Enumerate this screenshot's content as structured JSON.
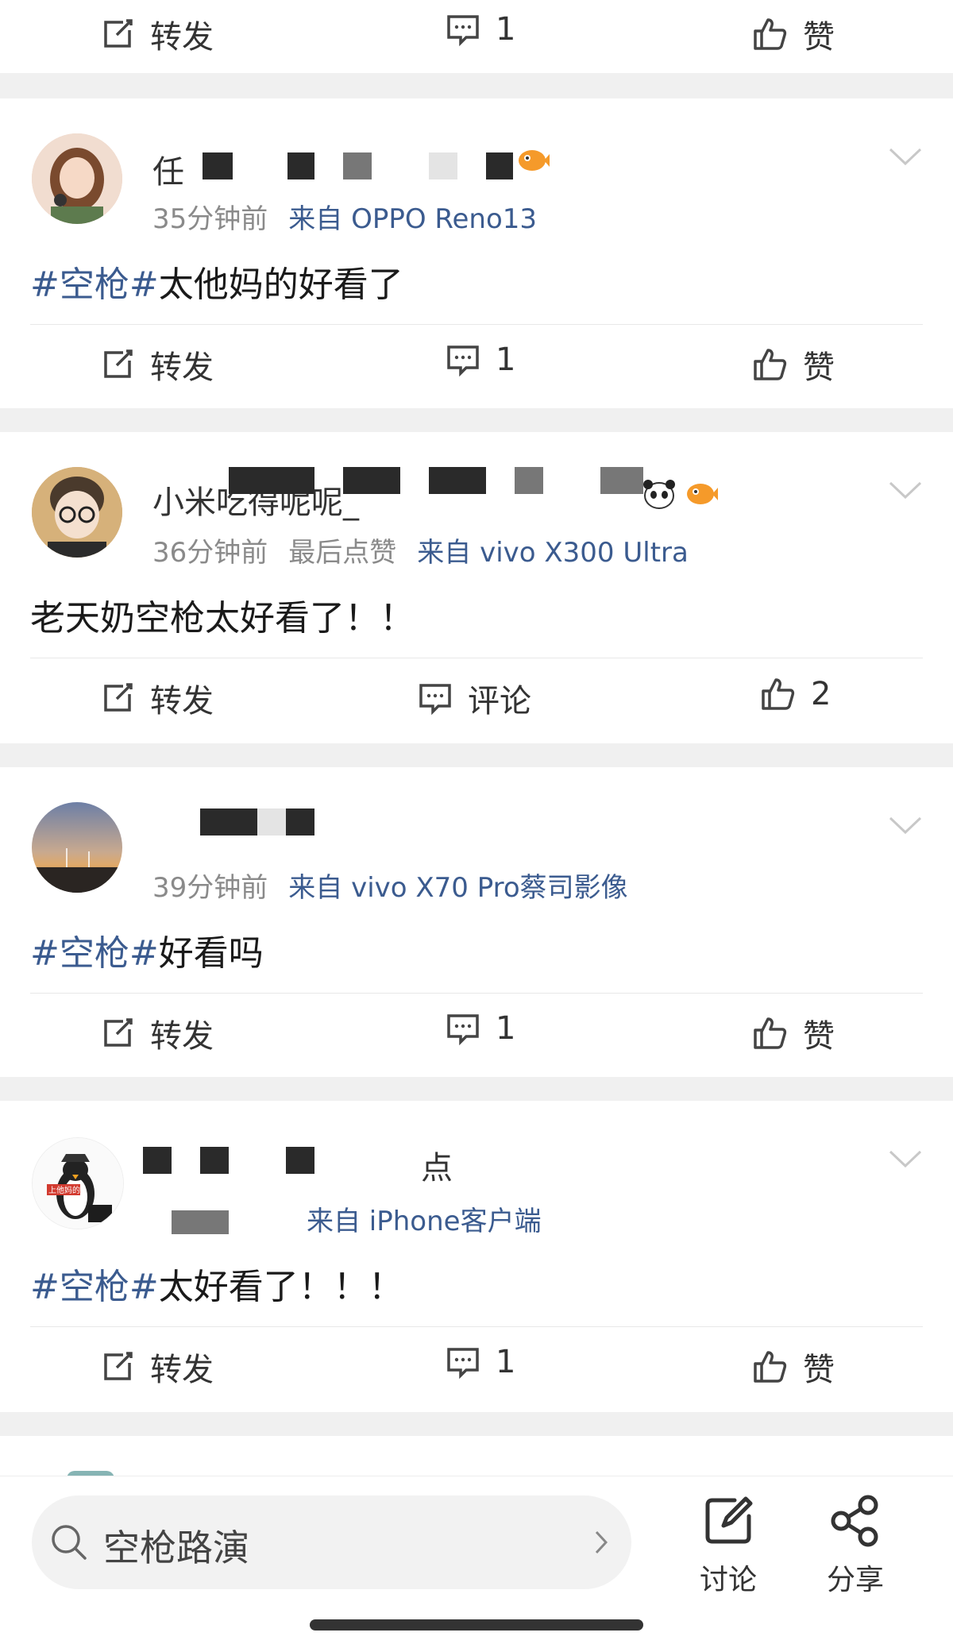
{
  "top_action_bar": {
    "repost": "转发",
    "comment": "1",
    "like": "赞"
  },
  "posts": [
    {
      "username_partial": "任",
      "time": "35分钟前",
      "source": "来自 OPPO Reno13",
      "tag": "#空枪#",
      "text": "太他妈的好看了",
      "actions": {
        "repost": "转发",
        "comment": "1",
        "like": "赞"
      }
    },
    {
      "username_partial": "小米吃得呢呢_",
      "time": "36分钟前",
      "extra": "最后点赞",
      "source": "来自 vivo X300 Ultra",
      "tag": "",
      "text": "老天奶空枪太好看了！！",
      "actions": {
        "repost": "转发",
        "comment": "评论",
        "like": "2"
      }
    },
    {
      "username_partial": "",
      "time": "39分钟前",
      "source": "来自 vivo X70 Pro蔡司影像",
      "tag": "#空枪#",
      "text": "好看吗",
      "actions": {
        "repost": "转发",
        "comment": "1",
        "like": "赞"
      }
    },
    {
      "username_partial": "点",
      "time": "",
      "source": "来自 iPhone客户端",
      "avatar_caption": "上他妈的",
      "tag": "#空枪#",
      "text": "太好看了！！！",
      "actions": {
        "repost": "转发",
        "comment": "1",
        "like": "赞"
      }
    }
  ],
  "bottom_bar": {
    "search_text": "空枪路演",
    "discuss_label": "讨论",
    "share_label": "分享"
  },
  "colors": {
    "link": "#3b5b8f",
    "meta": "#8a8a8a",
    "separator": "#f0f0f0"
  }
}
